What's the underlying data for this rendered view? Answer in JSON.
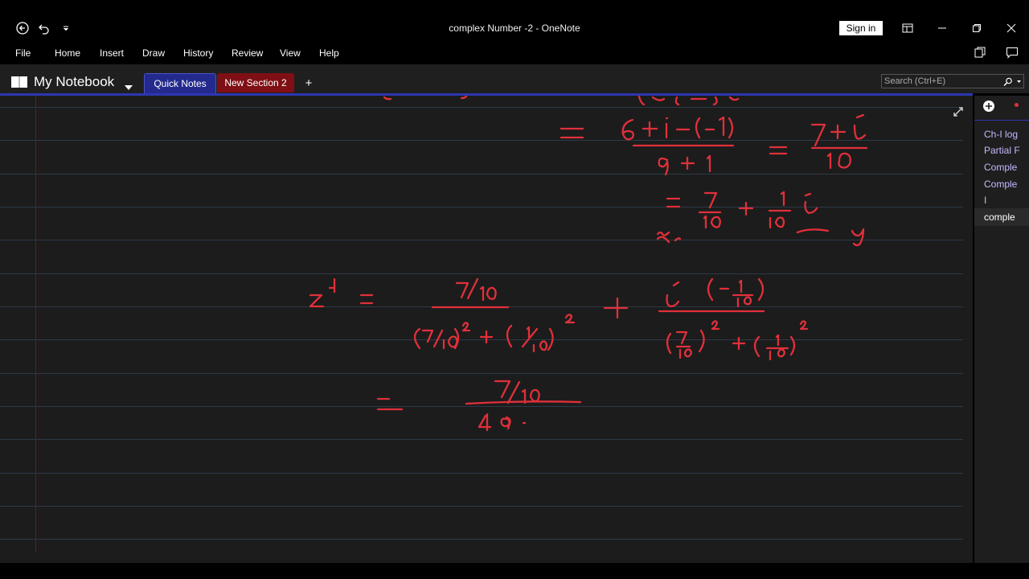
{
  "window": {
    "title": "complex Number -2  -  OneNote",
    "sign_in": "Sign in"
  },
  "menu": [
    "File",
    "Home",
    "Insert",
    "Draw",
    "History",
    "Review",
    "View",
    "Help"
  ],
  "notebook": {
    "name": "My Notebook",
    "sections": [
      "Quick Notes",
      "New Section 2"
    ],
    "add_section": "+"
  },
  "search": {
    "placeholder": "Search (Ctrl+E)"
  },
  "pages": [
    "Ch-I log",
    "Partial F",
    "Comple",
    "Comple",
    "I",
    "comple"
  ],
  "colors": {
    "ink": "#e0303a",
    "tab_quick": "#242a8d",
    "tab_new": "#7f0f14",
    "page_text": "#c7b6ff"
  }
}
